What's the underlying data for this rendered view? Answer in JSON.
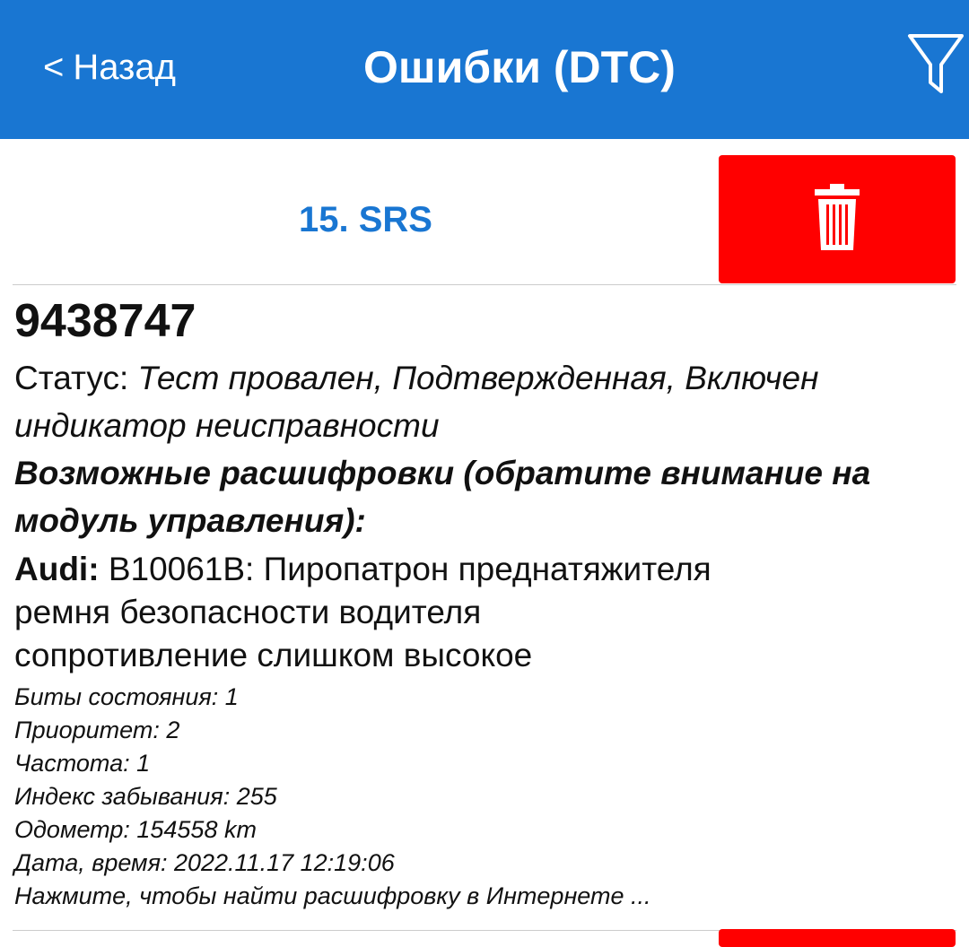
{
  "header": {
    "back_chevron": "<",
    "back_label": "Назад",
    "title": "Ошибки (DTC)",
    "filter_icon": "filter-funnel-icon",
    "background_color": "#1976d2"
  },
  "module": {
    "title": "15. SRS",
    "delete_icon": "trash-icon",
    "delete_color": "#ff0000"
  },
  "dtc": {
    "code": "9438747",
    "status_label": "Статус:",
    "status_value": "Тест провален, Подтвержденная, Включен индикатор неисправности",
    "decode_heading": "Возможные расшифровки (обратите внимание на модуль управления):",
    "brand": "Audi:",
    "decode_line1": "B10061B: Пиропатрон преднатяжителя",
    "decode_line2": "ремня безопасности водителя",
    "decode_line3": "сопротивление слишком высокое",
    "details": [
      "Биты состояния: 1",
      "Приоритет: 2",
      "Частота: 1",
      "Индекс забывания: 255",
      "Одометр: 154558 km",
      "Дата, время: 2022.11.17 12:19:06"
    ],
    "search_link": "Нажмите, чтобы найти расшифровку в Интернете ..."
  }
}
